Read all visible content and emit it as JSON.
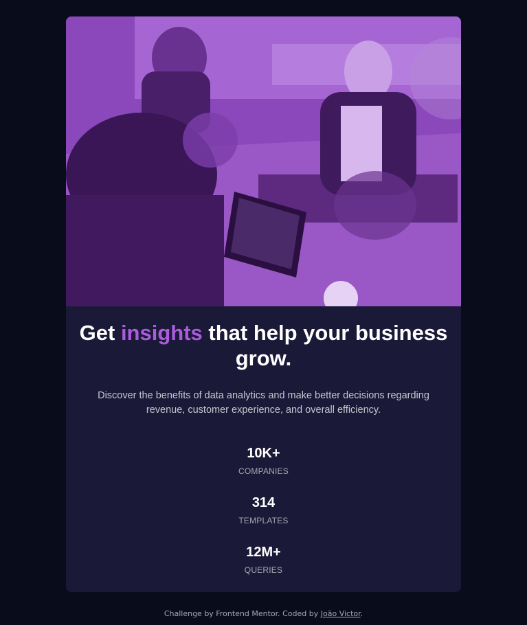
{
  "hero": {
    "image_alt": "People working at desks in an office",
    "overlay_color": "#aa5cdb"
  },
  "title": {
    "before": "Get ",
    "accent": "insights",
    "after": " that help your business grow."
  },
  "description": "Discover the benefits of data analytics and make better decisions regarding revenue, customer experience, and overall efficiency.",
  "stats": [
    {
      "value": "10K+",
      "label": "COMPANIES"
    },
    {
      "value": "314",
      "label": "TEMPLATES"
    },
    {
      "value": "12M+",
      "label": "QUERIES"
    }
  ],
  "footer": {
    "text": "Challenge by Frontend Mentor. Coded by ",
    "author": "João Victor",
    "end": "."
  },
  "colors": {
    "page_bg": "#090c1b",
    "card_bg": "#1b1938",
    "accent": "#aa5cdb"
  }
}
